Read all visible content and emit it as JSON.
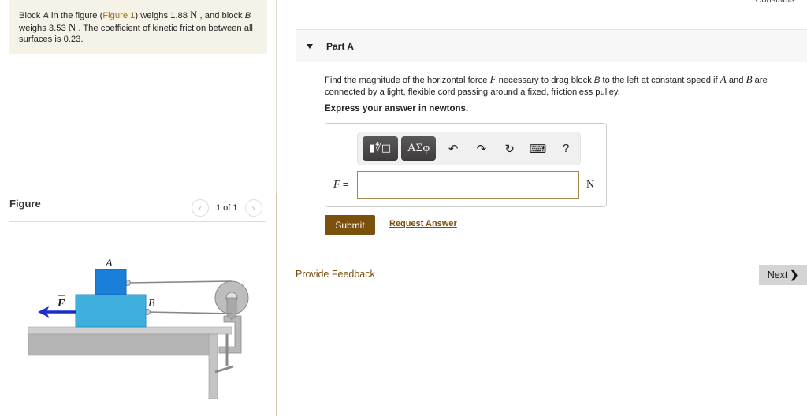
{
  "problem": {
    "part1": "Block ",
    "var_a": "A",
    "part2": " in the figure (",
    "figure_link": "Figure 1",
    "part3": ") weighs 1.88 ",
    "unit_n": "N",
    "part4": " , and block ",
    "var_b": "B",
    "part5": " weighs 3.53 ",
    "part6": " . The coefficient of kinetic friction between all surfaces is 0.23."
  },
  "figure_panel": {
    "title": "Figure",
    "pager": "1 of 1",
    "prev_icon": "chevron-left-icon",
    "next_icon": "chevron-right-icon",
    "labels": {
      "block_a": "A",
      "block_b": "B",
      "force": "F"
    },
    "colors": {
      "block_a": "#1a7fd9",
      "block_b": "#3fb0de",
      "arrow": "#1a2fc8",
      "table": "#b4b4b4"
    }
  },
  "header": {
    "constants_link": "Constants"
  },
  "part": {
    "title": "Part A",
    "question_1": "Find the magnitude of the horizontal force ",
    "question_f": "F",
    "question_2": " necessary to drag block ",
    "question_b": "B",
    "question_3": " to the left at constant speed if ",
    "question_a2": "A",
    "question_and": " and ",
    "question_b2": "B",
    "question_4": " are connected by a light, flexible cord passing around a fixed, frictionless pulley.",
    "instruction": "Express your answer in newtons."
  },
  "toolbar": {
    "templates_label": "▮∜□",
    "greek_label": "ΑΣφ",
    "undo": "↶",
    "redo": "↷",
    "reset": "↻",
    "keyboard": "⌨",
    "help": "?"
  },
  "answer": {
    "var_label": "F",
    "equals": " =",
    "value": "",
    "unit": "N"
  },
  "actions": {
    "submit": "Submit",
    "request_answer": "Request Answer",
    "feedback": "Provide Feedback",
    "next": "Next",
    "next_chevron": "❯"
  }
}
